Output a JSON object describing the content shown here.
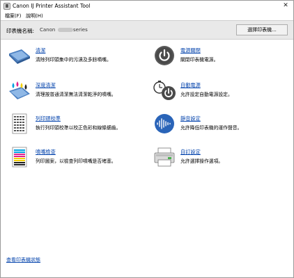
{
  "window": {
    "title": "Canon IJ Printer Assistant Tool",
    "close_glyph": "✕"
  },
  "menu": {
    "items": [
      {
        "label": "檔案(F)"
      },
      {
        "label": "說明(H)"
      }
    ]
  },
  "printer": {
    "label": "印表機名稱:",
    "name_prefix": "Canon",
    "name_suffix": "series",
    "select_button": "選擇印表機..."
  },
  "features": [
    {
      "title": "清潔",
      "desc": "清除列印頭集中的污漬及多餘噴嘴。"
    },
    {
      "title": "深度清潔",
      "desc": "清理按普通清潔無法清潔乾淨的噴嘴。"
    },
    {
      "title": "列印頭校準",
      "desc": "執行列印頭校準以校正色彩和線條鋸齒。"
    },
    {
      "title": "噴嘴檢查",
      "desc": "列印圖案，以檢查列印噴嘴是否堵塞。"
    },
    {
      "title": "電源關閉",
      "desc": "關閉印表機電源。"
    },
    {
      "title": "自動電源",
      "desc": "允許設定自動電源設定。"
    },
    {
      "title": "靜音設定",
      "desc": "允許降低印表機的運作聲音。"
    },
    {
      "title": "自訂設定",
      "desc": "允許選擇操作選項。"
    }
  ],
  "footer": {
    "status_link": "查看印表機狀態"
  },
  "colors": {
    "link": "#0645ad",
    "bar": "#e9e9e9"
  }
}
